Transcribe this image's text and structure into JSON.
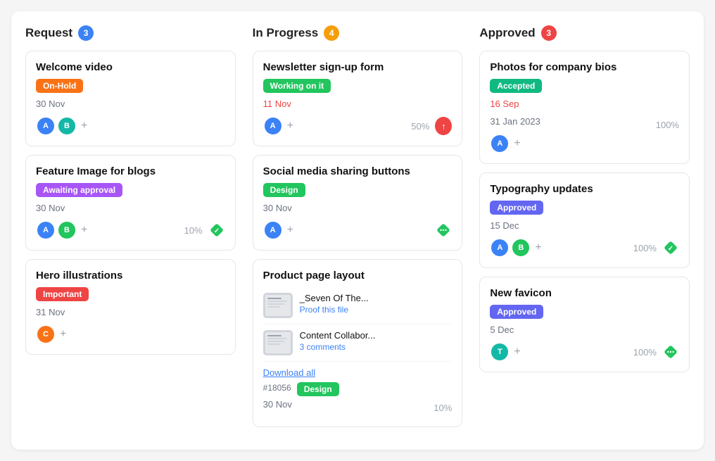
{
  "columns": [
    {
      "id": "request",
      "title": "Request",
      "badge": "3",
      "badge_class": "badge-blue",
      "cards": [
        {
          "id": "welcome-video",
          "title": "Welcome video",
          "tag": "On-Hold",
          "tag_class": "tag-orange",
          "date": "30 Nov",
          "date_overdue": false,
          "avatars": [
            {
              "color": "avatar-blue",
              "label": "A"
            },
            {
              "color": "avatar-teal",
              "label": "B"
            }
          ],
          "show_plus": true,
          "percent": null,
          "icon": null
        },
        {
          "id": "feature-image",
          "title": "Feature Image for blogs",
          "tag": "Awaiting approval",
          "tag_class": "tag-purple",
          "date": "30 Nov",
          "date_overdue": false,
          "avatars": [
            {
              "color": "avatar-blue",
              "label": "A"
            },
            {
              "color": "avatar-green",
              "label": "B"
            }
          ],
          "show_plus": true,
          "percent": "10%",
          "icon": "check-diamond"
        },
        {
          "id": "hero-illustrations",
          "title": "Hero illustrations",
          "tag": "Important",
          "tag_class": "tag-red",
          "date": "31 Nov",
          "date_overdue": false,
          "avatars": [
            {
              "color": "avatar-orange",
              "label": "C"
            }
          ],
          "show_plus": true,
          "percent": null,
          "icon": null
        }
      ]
    },
    {
      "id": "in-progress",
      "title": "In Progress",
      "badge": "4",
      "badge_class": "badge-yellow",
      "cards": [
        {
          "id": "newsletter",
          "title": "Newsletter sign-up form",
          "tag": "Working on it",
          "tag_class": "tag-green",
          "date": "11 Nov",
          "date_overdue": true,
          "avatars": [
            {
              "color": "avatar-blue",
              "label": "A"
            }
          ],
          "show_plus": true,
          "percent": "50%",
          "icon": "upload"
        },
        {
          "id": "social-media",
          "title": "Social media sharing buttons",
          "tag": "Design",
          "tag_class": "tag-green",
          "date": "30 Nov",
          "date_overdue": false,
          "avatars": [
            {
              "color": "avatar-blue",
              "label": "A"
            }
          ],
          "show_plus": true,
          "percent": null,
          "icon": "dots-diamond"
        },
        {
          "id": "product-page",
          "title": "Product page layout",
          "tag": null,
          "tag_class": null,
          "date": null,
          "date_overdue": false,
          "files": [
            {
              "name": "_Seven Of The...",
              "action": "Proof this file",
              "thumb_color": "#d1d5db"
            },
            {
              "name": "Content Collabor...",
              "action": "3 comments",
              "thumb_color": "#d1d5db"
            }
          ],
          "download_all": "Download all",
          "meta_id": "#18056",
          "meta_tag": "Design",
          "meta_tag_class": "tag-green",
          "meta_date": "30 Nov",
          "meta_percent": "10%",
          "avatars": [],
          "show_plus": false,
          "percent": null,
          "icon": null
        }
      ]
    },
    {
      "id": "approved",
      "title": "Approved",
      "badge": "3",
      "badge_class": "badge-red",
      "cards": [
        {
          "id": "photos-bios",
          "title": "Photos for company bios",
          "tag": "Accepted",
          "tag_class": "tag-blue-green",
          "date": "16 Sep",
          "date_overdue": true,
          "date2": "31 Jan 2023",
          "avatars": [
            {
              "color": "avatar-blue",
              "label": "A"
            }
          ],
          "show_plus": true,
          "percent": "100%",
          "icon": null
        },
        {
          "id": "typography",
          "title": "Typography updates",
          "tag": "Approved",
          "tag_class": "tag-indigo",
          "date": "15 Dec",
          "date_overdue": false,
          "avatars": [
            {
              "color": "avatar-blue",
              "label": "A"
            },
            {
              "color": "avatar-green",
              "label": "B"
            }
          ],
          "show_plus": true,
          "percent": "100%",
          "icon": "check-diamond"
        },
        {
          "id": "new-favicon",
          "title": "New favicon",
          "tag": "Approved",
          "tag_class": "tag-indigo",
          "date": "5 Dec",
          "date_overdue": false,
          "avatars": [
            {
              "color": "avatar-teal",
              "label": "T"
            }
          ],
          "show_plus": true,
          "percent": "100%",
          "icon": "dots-diamond"
        }
      ]
    }
  ]
}
